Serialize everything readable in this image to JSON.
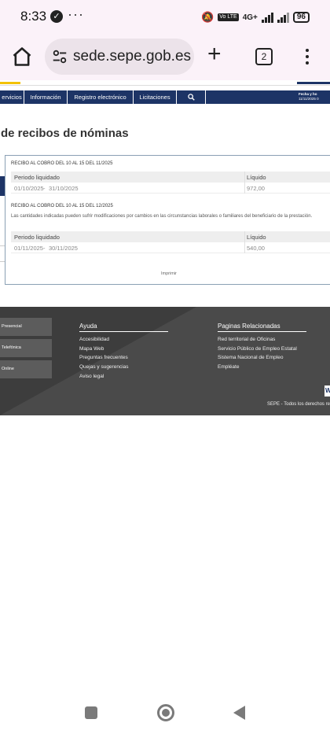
{
  "status_bar": {
    "time": "8:33",
    "notification_badge": "✓",
    "more_dots": "···",
    "network_badge": "Vo LTE",
    "network_type": "4G+",
    "battery": "96"
  },
  "browser": {
    "url": "sede.sepe.gob.es",
    "tab_count": "2",
    "icons": [
      "home-icon",
      "tune-icon",
      "plus-icon",
      "tabs-icon",
      "more-vert-icon"
    ]
  },
  "nav": {
    "items": [
      "ervicios",
      "Información",
      "Registro electrónico",
      "Licitaciones"
    ],
    "search_icon": "🔍",
    "date_label": "Fecha y ho",
    "date_value": "11/11/2025 0"
  },
  "page_title": "de recibos de nóminas",
  "receipts": [
    {
      "title": "RECIBO AL COBRO DEL 10 AL 15 DEL 11/2025",
      "note": "",
      "headers": [
        "Periodo liquidado",
        "Líquido"
      ],
      "period_from": "01/10/2025",
      "period_sep": "-",
      "period_to": "31/10/2025",
      "amount": "972,00"
    },
    {
      "title": "RECIBO AL COBRO DEL 10 AL 15 DEL 12/2025",
      "note": "Las cantidades indicadas pueden sufrir modificaciones por cambios en las circunstancias laborales o familiares del beneficiario de la prestación.",
      "headers": [
        "Periodo liquidado",
        "Líquido"
      ],
      "period_from": "01/11/2025",
      "period_sep": "-",
      "period_to": "30/11/2025",
      "amount": "540,00"
    }
  ],
  "print_label": "Imprimir",
  "footer": {
    "channels": [
      "Presencial",
      "Telefónica",
      "Online"
    ],
    "help_title": "Ayuda",
    "help_links": [
      "Accesibilidad",
      "Mapa Web",
      "Preguntas frecuentes",
      "Quejas y sugerencias",
      "Aviso legal"
    ],
    "related_title": "Paginas Relacionadas",
    "related_links": [
      "Red territorial de Oficinas",
      "Servicio Público de Empleo Estatal",
      "Sistema Nacional de Empleo",
      "Empléate"
    ],
    "copyright": "SEPE - Todos los derechos re",
    "badge": "W"
  },
  "colors": {
    "navy": "#1d3466",
    "accent_yellow": "#f2c200",
    "footer_bg": "#4a4a4a"
  }
}
